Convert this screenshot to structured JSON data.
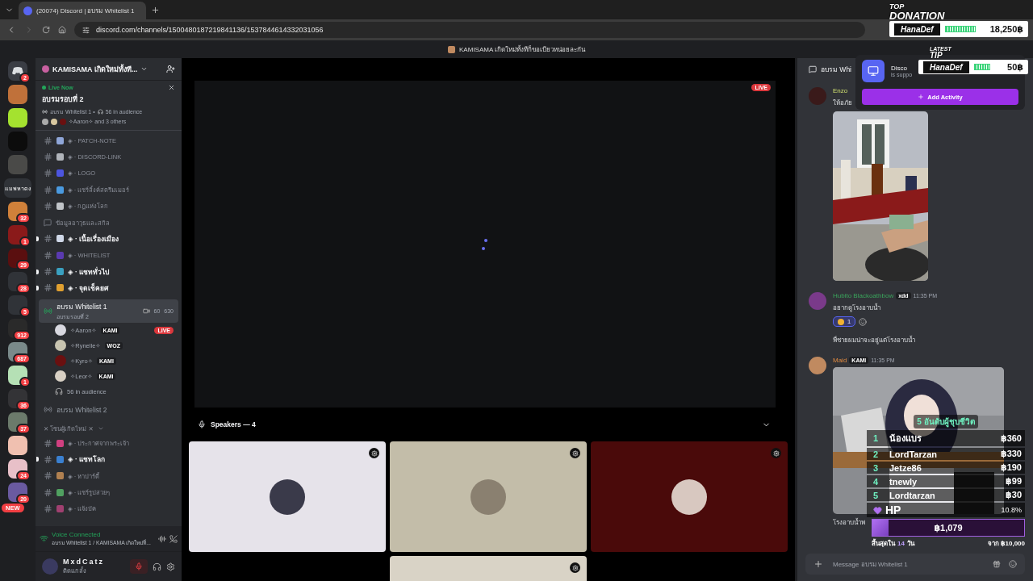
{
  "browser": {
    "tabs": [
      {
        "title": "(20074) Discord | อบรม Whitelist 1",
        "selected": true
      }
    ],
    "url": "discord.com/channels/1500480187219841136/1537844614332031056"
  },
  "app_title": "KAMISAMA เกิดใหม่ทั้งทีก็ขอเบียวหน่อยละกัน",
  "servers": [
    {
      "kind": "home",
      "badge": "2"
    },
    {
      "kind": "server"
    },
    {
      "kind": "server"
    },
    {
      "kind": "server"
    },
    {
      "kind": "server"
    },
    {
      "kind": "label",
      "label": "แมพหาดง"
    },
    {
      "kind": "server",
      "badge": "32"
    },
    {
      "kind": "server",
      "badge": "1"
    },
    {
      "kind": "server",
      "badge": "29"
    },
    {
      "kind": "server",
      "badge": "28"
    },
    {
      "kind": "server",
      "badge": "5"
    },
    {
      "kind": "server",
      "badge": "912"
    },
    {
      "kind": "server",
      "badge": "687"
    },
    {
      "kind": "server",
      "badge": "1"
    },
    {
      "kind": "server",
      "badge": "36"
    },
    {
      "kind": "server",
      "badge": "37"
    },
    {
      "kind": "server"
    },
    {
      "kind": "server",
      "badge": "24"
    },
    {
      "kind": "server",
      "badge": "20",
      "new": "NEW"
    }
  ],
  "server_name": "KAMISAMA เกิดใหม่ทั้งที...",
  "live_card": {
    "label": "Live Now",
    "title": "อบรมรอบที่ 2",
    "channel": "อบรม Whitelist 1 •",
    "audience": "56 in audience",
    "watchers": "✧Aaron✧ and 3 others"
  },
  "channels": [
    {
      "kind": "text",
      "name": "◈ · PATCH-NOTE",
      "unread": false
    },
    {
      "kind": "text",
      "name": "◈ · DISCORD-LINK",
      "unread": false
    },
    {
      "kind": "text",
      "name": "◈ · LOGO",
      "unread": false
    },
    {
      "kind": "text",
      "name": "◈ · แชร์ลิ้งค์สตรีมเมอร์",
      "unread": false
    },
    {
      "kind": "text",
      "name": "◈ · กฎแห่งโลก",
      "unread": false
    },
    {
      "kind": "forum",
      "name": "ข้อมูลอาวุธและสกิล",
      "unread": false
    },
    {
      "kind": "text",
      "name": "◈ · เนื้อเรื่องเมือง",
      "unread": true
    },
    {
      "kind": "text",
      "name": "◈ · WHITELIST",
      "unread": false
    },
    {
      "kind": "text",
      "name": "◈ · แชททั่วไป",
      "unread": true
    },
    {
      "kind": "text",
      "name": "◈ · จุดเช็คยศ",
      "unread": true
    },
    {
      "kind": "voice",
      "name": "อบรม Whitelist 1",
      "sub": "อบรมรอบที่ 2",
      "video": "60",
      "count": "630",
      "selected": true,
      "members": [
        {
          "name": "✧Aaron✧",
          "tag": "KAMI",
          "live": true
        },
        {
          "name": "✧Rynelle✧",
          "tag": "WOZ",
          "live": false
        },
        {
          "name": "✧Kyro✧",
          "tag": "KAMI",
          "live": false
        },
        {
          "name": "✧Leor✧",
          "tag": "KAMI",
          "live": false
        }
      ],
      "live_label": "LIVE",
      "audience": "56 in audience"
    },
    {
      "kind": "voice",
      "name": "อบรม Whitelist 2",
      "selected": false
    },
    {
      "kind": "category",
      "name": "✕ โซนผู้เกิดใหม่ ✕"
    },
    {
      "kind": "text",
      "name": "◈ · ประกาศจากพระเจ้า",
      "unread": false
    },
    {
      "kind": "text",
      "name": "◈ · แชทโลก",
      "unread": true
    },
    {
      "kind": "text",
      "name": "◈ · หาปาร์ตี้",
      "unread": false
    },
    {
      "kind": "text",
      "name": "◈ · แชร์รูปสวยๆ",
      "unread": false
    },
    {
      "kind": "text",
      "name": "◈ · แจ้งบัค",
      "unread": false
    }
  ],
  "voice_status": {
    "label": "Voice Connected",
    "detail": "อบรม Whitelist 1 / KAMISAMA เกิดใหม่ที่..."
  },
  "user": {
    "name": "MxdCatz",
    "status": "ติดแกลั้ง",
    "muted": true
  },
  "stage": {
    "live": "LIVE",
    "speakers_label": "Speakers — 4",
    "speakers": [
      {
        "kind": "speaker"
      },
      {
        "kind": "speaker"
      },
      {
        "kind": "speaker"
      },
      {
        "kind": "speaker_cut"
      }
    ]
  },
  "chat": {
    "header": "อบรม Whi",
    "placeholder": "Message อบรม Whitelist 1",
    "messages": [
      {
        "kind": "image_first",
        "author": "Enzo",
        "text": "ให้อภัย"
      },
      {
        "kind": "text",
        "author": "Hubito Blackoathbow",
        "tag": "xdd",
        "time": "11:35 PM",
        "text": "อยากดูโรงอาบน้ำ",
        "reaction": "1",
        "followup": "พี่ชายผมน่าจะอยู่แต่โรงอาบน้ำ"
      },
      {
        "kind": "image_last",
        "author": "Maid",
        "tag": "KAMI",
        "time": "11:35 PM",
        "text": "โรงอาบน้ำพ"
      }
    ]
  },
  "activity_popup": {
    "title": "Disco",
    "sub": "is suppo",
    "button": "Add Activity"
  },
  "donation_widget": {
    "top": "TOP",
    "top2": "DONATION",
    "top_name": "HanaDef",
    "top_amount": "18,250฿",
    "latest": "LATEST",
    "latest2": "TIP",
    "latest_name": "HanaDef",
    "latest_amount": "50฿"
  },
  "leaderboard": {
    "title": "5 อันดับผู้ชุบชีวิต",
    "rows": [
      {
        "rank": "1",
        "name": "น้องแบร",
        "amount": "฿360"
      },
      {
        "rank": "2",
        "name": "LordTarzan",
        "amount": "฿330"
      },
      {
        "rank": "3",
        "name": "Jetze86",
        "amount": "฿190"
      },
      {
        "rank": "4",
        "name": "tnewly",
        "amount": "฿99"
      },
      {
        "rank": "5",
        "name": "Lordtarzan",
        "amount": "฿30"
      }
    ],
    "hp_label": "HP",
    "percent": "10.8%",
    "level": 0.108,
    "total": "฿1,079",
    "ends": "สิ้นสุดใน",
    "days": "14",
    "days_unit": "วัน",
    "goal": "จาก ฿10,000"
  }
}
